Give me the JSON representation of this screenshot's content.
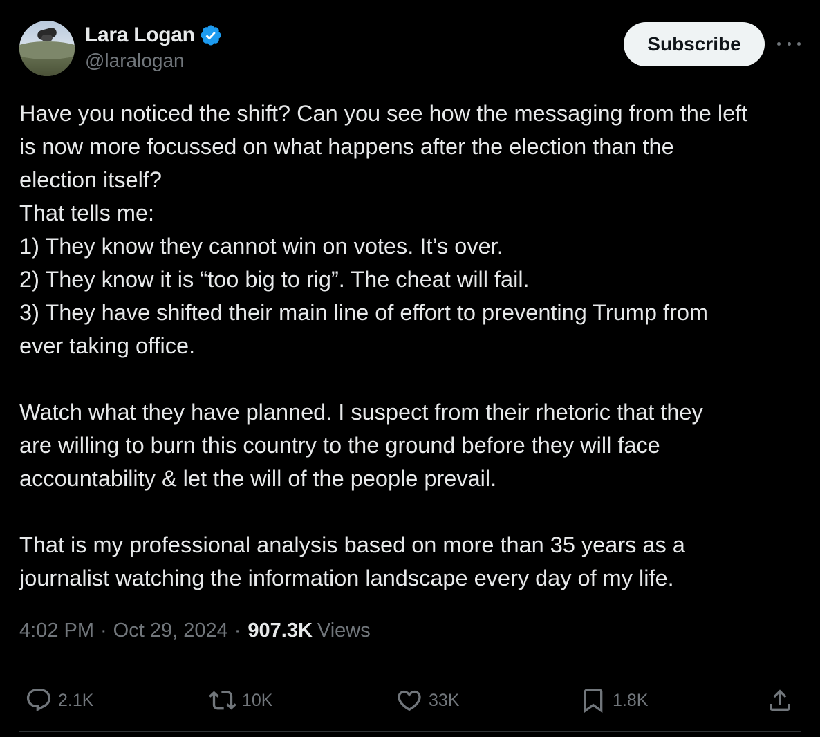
{
  "author": {
    "name": "Lara Logan",
    "handle": "@laralogan",
    "verified": true
  },
  "subscribe_label": "Subscribe",
  "tweet": {
    "lines": [
      "Have you noticed the shift? Can you see how the messaging from the left",
      "is now more focussed on what happens after the election than the",
      "election itself?",
      "That tells me:",
      "1) They know they cannot win on votes. It’s over.",
      "2) They know it is “too big to rig”. The cheat will fail.",
      "3) They have shifted their main line of effort to preventing Trump from",
      "ever taking office.",
      "",
      "Watch what they have planned. I suspect from their rhetoric that they",
      "are willing to burn this country to the ground before they will face",
      "accountability & let the will of the people prevail.",
      "",
      "That is my professional analysis based on more than 35 years as a",
      "journalist watching the information landscape every day of my life."
    ]
  },
  "meta": {
    "time": "4:02 PM",
    "date": "Oct 29, 2024",
    "views_count": "907.3K",
    "views_label": "Views"
  },
  "actions": {
    "replies": "2.1K",
    "reposts": "10K",
    "likes": "33K",
    "bookmarks": "1.8K"
  },
  "colors": {
    "background": "#000000",
    "text": "#e7e9ea",
    "muted": "#71767b",
    "verified": "#1d9bf0",
    "button_bg": "#eff3f4"
  },
  "icons": [
    "verified-badge-icon",
    "more-icon",
    "reply-icon",
    "repost-icon",
    "like-icon",
    "bookmark-icon",
    "share-icon"
  ]
}
